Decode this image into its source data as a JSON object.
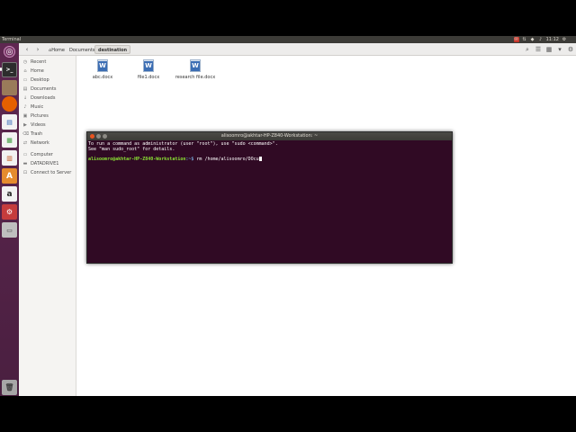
{
  "topbar": {
    "title": "Terminal",
    "clock": "11:12",
    "indicators": [
      "✉",
      "⇅",
      "◆",
      "♪",
      "⚙"
    ]
  },
  "navbar": {
    "crumbs": [
      "Home",
      "Documents",
      "destination"
    ]
  },
  "sidebar": {
    "items": [
      {
        "label": "Recent",
        "icon": "clock-icon"
      },
      {
        "label": "Home",
        "icon": "home-icon"
      },
      {
        "label": "Desktop",
        "icon": "desktop-icon"
      },
      {
        "label": "Documents",
        "icon": "folder-icon"
      },
      {
        "label": "Downloads",
        "icon": "download-icon"
      },
      {
        "label": "Music",
        "icon": "music-icon"
      },
      {
        "label": "Pictures",
        "icon": "pictures-icon"
      },
      {
        "label": "Videos",
        "icon": "video-icon"
      },
      {
        "label": "Trash",
        "icon": "trash-icon"
      },
      {
        "label": "Network",
        "icon": "network-icon"
      },
      {
        "label": "Computer",
        "icon": "computer-icon"
      },
      {
        "label": "DATADRIVE1",
        "icon": "drive-icon"
      },
      {
        "label": "Connect to Server",
        "icon": "server-icon"
      }
    ]
  },
  "files": [
    {
      "name": "abc.docx"
    },
    {
      "name": "file1.docx"
    },
    {
      "name": "research file.docx"
    }
  ],
  "terminal": {
    "title": "alisoomro@akhtar-HP-Z840-Workstation: ~",
    "line1": "To run a command as administrator (user \"root\"), use \"sudo <command>\".",
    "line2": "See \"man sudo_root\" for details.",
    "prompt_user": "alisoomro@akhtar-HP-Z840-Workstation",
    "prompt_path": ":~$",
    "command": " rm /home/alisoomro/DOcu"
  },
  "colors": {
    "launcher": "#5e2750",
    "terminal_bg": "#300a24",
    "prompt_green": "#8ae234"
  }
}
